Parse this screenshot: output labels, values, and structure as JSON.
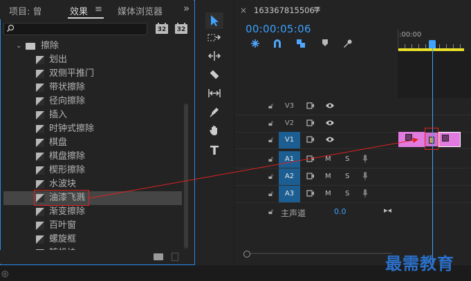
{
  "tabs": {
    "project": "项目: 曾",
    "effects": "效果",
    "effects_menu": "≡",
    "media_browser": "媒体浏览器",
    "overflow": "»"
  },
  "search": {
    "placeholder": ""
  },
  "bins": {
    "new_bin_1": "32",
    "new_bin_2": "32"
  },
  "folder": {
    "label": "擦除"
  },
  "effects": [
    "划出",
    "双侧平推门",
    "带状擦除",
    "径向擦除",
    "插入",
    "时钟式擦除",
    "棋盘",
    "棋盘擦除",
    "楔形擦除",
    "水波块",
    "油漆飞溅",
    "渐变擦除",
    "百叶窗",
    "螺旋框",
    "随机块"
  ],
  "selected_effect_index": 10,
  "timeline": {
    "close": "×",
    "title": "1633678155067",
    "menu": "≡",
    "timecode": "00:00:05:06",
    "ruler_label": ":00:00",
    "tracks": [
      {
        "name": "V3",
        "active": false
      },
      {
        "name": "V2",
        "active": false
      },
      {
        "name": "V1",
        "active": true
      },
      {
        "name": "A1",
        "active": true
      },
      {
        "name": "A2",
        "active": true
      },
      {
        "name": "A3",
        "active": true
      }
    ],
    "audio_m": "M",
    "audio_s": "S",
    "master_label": "主声道",
    "master_value": "0.0"
  },
  "watermark": "最需教育",
  "colors": {
    "accent": "#2d8ceb",
    "timecode": "#3aa0ff",
    "clip": "#e27be0",
    "annotation": "#e02323"
  }
}
